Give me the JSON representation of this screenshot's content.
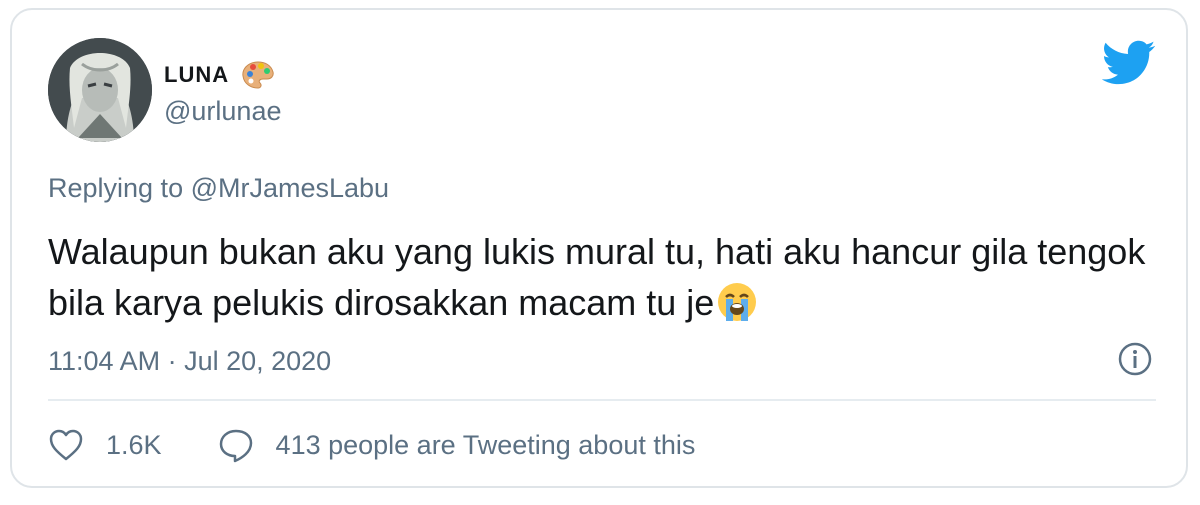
{
  "tweet": {
    "display_name": "LUNA",
    "handle": "@urlunae",
    "reply_to": "Replying to @MrJamesLabu",
    "text": "Walaupun bukan aku yang lukis mural tu, hati aku hancur gila tengok bila karya pelukis dirosakkan macam tu je",
    "timestamp": "11:04 AM · Jul 20, 2020",
    "likes": "1.6K",
    "tweeting_about": "413 people are Tweeting about this"
  },
  "icons": {
    "name_emoji": "artist-palette-icon",
    "text_emoji": "loudly-crying-face-icon",
    "brand": "twitter-bird-icon",
    "info": "info-icon",
    "like": "heart-icon",
    "comment": "speech-bubble-icon"
  },
  "colors": {
    "twitter_blue": "#1da1f2",
    "text": "#14171a",
    "secondary": "#5b7083",
    "border": "#dfe4e8"
  }
}
